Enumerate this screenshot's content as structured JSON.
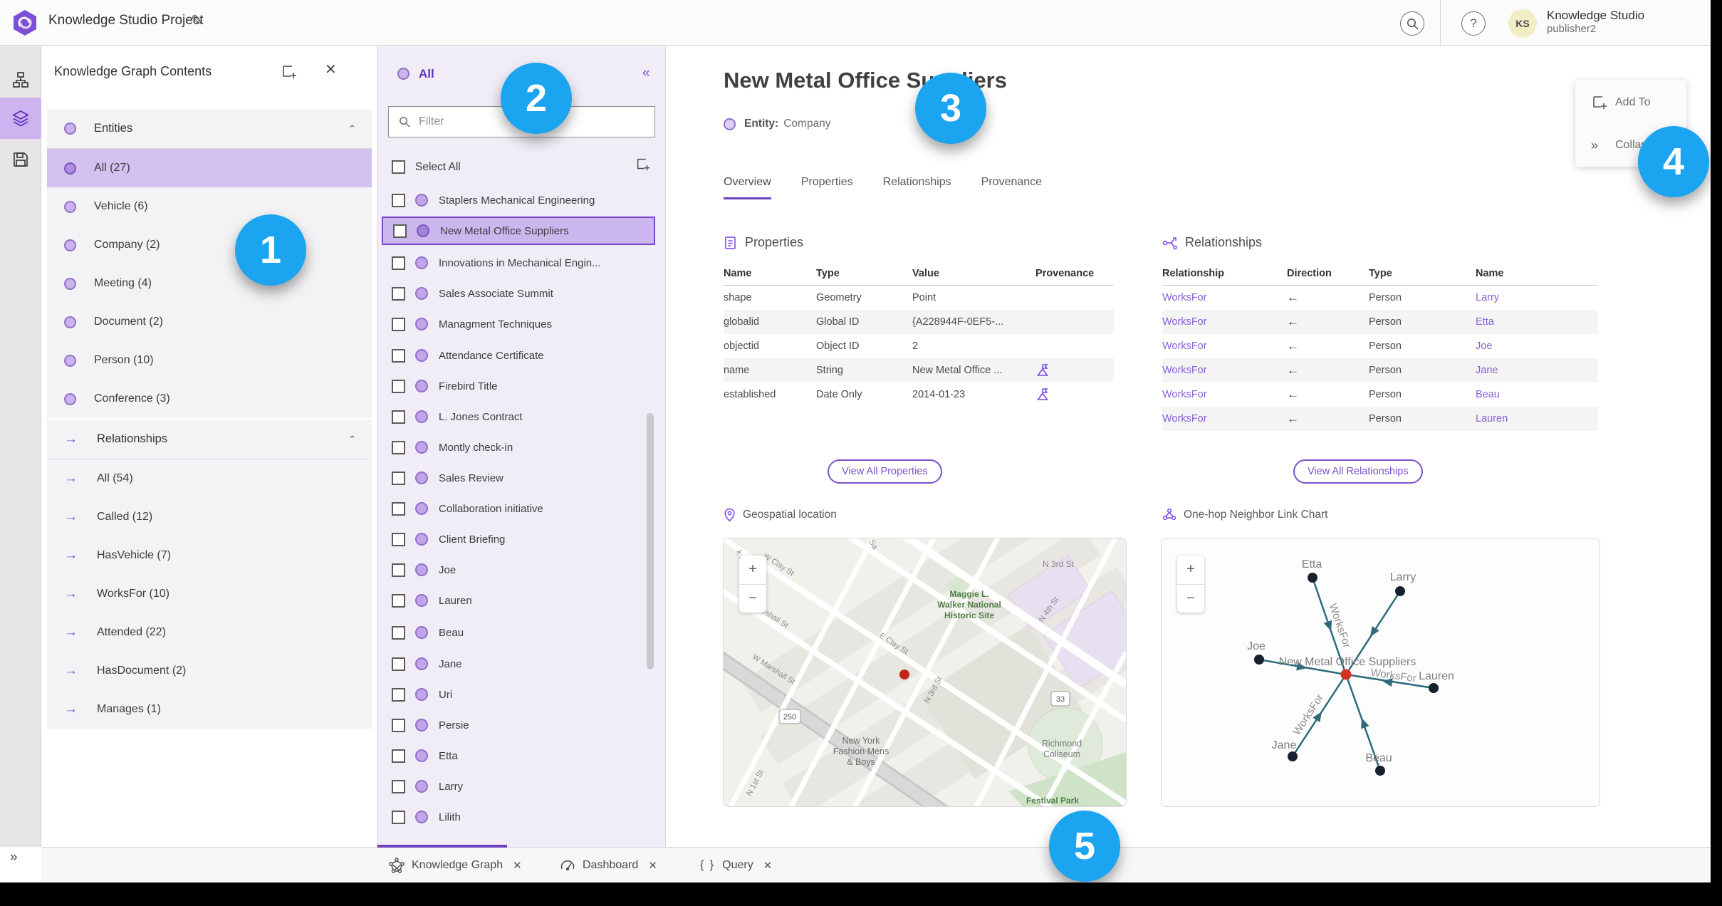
{
  "header": {
    "title": "Knowledge Studio Project",
    "search_tooltip": "search",
    "help_label": "?",
    "avatar_initials": "KS",
    "user_org": "Knowledge Studio",
    "user_name": "publisher2"
  },
  "sidebar": {
    "title": "Knowledge Graph Contents",
    "entities": {
      "label": "Entities",
      "items": [
        {
          "label": "All (27)",
          "selected": true
        },
        {
          "label": "Vehicle (6)"
        },
        {
          "label": "Company (2)"
        },
        {
          "label": "Meeting (4)"
        },
        {
          "label": "Document (2)"
        },
        {
          "label": "Person (10)"
        },
        {
          "label": "Conference (3)"
        }
      ]
    },
    "relationships": {
      "label": "Relationships",
      "items": [
        {
          "label": "All (54)"
        },
        {
          "label": "Called (12)"
        },
        {
          "label": "HasVehicle (7)"
        },
        {
          "label": "WorksFor (10)"
        },
        {
          "label": "Attended (22)"
        },
        {
          "label": "HasDocument (2)"
        },
        {
          "label": "Manages (1)"
        }
      ]
    }
  },
  "list_panel": {
    "header": "All",
    "filter_placeholder": "Filter",
    "select_all_label": "Select All",
    "selected_item": "New Metal Office Suppliers",
    "items": [
      "Staplers Mechanical Engineering",
      "New Metal Office Suppliers",
      "Innovations in Mechanical Engin...",
      "Sales Associate Summit",
      "Managment Techniques",
      "Attendance Certificate",
      "Firebird Title",
      "L. Jones Contract",
      "Montly check-in",
      "Sales Review",
      "Collaboration initiative",
      "Client Briefing",
      "Joe",
      "Lauren",
      "Beau",
      "Jane",
      "Uri",
      "Persie",
      "Etta",
      "Larry",
      "Lilith"
    ]
  },
  "detail": {
    "title": "New Metal Office Suppliers",
    "entity_label": "Entity:",
    "entity_type": "Company",
    "tabs": [
      "Overview",
      "Properties",
      "Relationships",
      "Provenance"
    ],
    "active_tab": "Overview",
    "properties": {
      "section_title": "Properties",
      "columns": [
        "Name",
        "Type",
        "Value",
        "Provenance"
      ],
      "rows": [
        {
          "name": "shape",
          "type": "Geometry",
          "value": "Point",
          "provenance": false
        },
        {
          "name": "globalid",
          "type": "Global ID",
          "value": "{A228944F-0EF5-...",
          "provenance": false
        },
        {
          "name": "objectid",
          "type": "Object ID",
          "value": "2",
          "provenance": false
        },
        {
          "name": "name",
          "type": "String",
          "value": "New Metal Office ...",
          "provenance": true
        },
        {
          "name": "established",
          "type": "Date Only",
          "value": "2014-01-23",
          "provenance": true
        }
      ],
      "view_all_label": "View All Properties"
    },
    "relationships": {
      "section_title": "Relationships",
      "columns": [
        "Relationship",
        "Direction",
        "Type",
        "Name"
      ],
      "rows": [
        {
          "relationship": "WorksFor",
          "direction": "←",
          "type": "Person",
          "name": "Larry"
        },
        {
          "relationship": "WorksFor",
          "direction": "←",
          "type": "Person",
          "name": "Etta"
        },
        {
          "relationship": "WorksFor",
          "direction": "←",
          "type": "Person",
          "name": "Joe"
        },
        {
          "relationship": "WorksFor",
          "direction": "←",
          "type": "Person",
          "name": "Jane"
        },
        {
          "relationship": "WorksFor",
          "direction": "←",
          "type": "Person",
          "name": "Beau"
        },
        {
          "relationship": "WorksFor",
          "direction": "←",
          "type": "Person",
          "name": "Lauren"
        }
      ],
      "view_all_label": "View All Relationships"
    },
    "map_section_title": "Geospatial location",
    "link_chart_section_title": "One-hop Neighbor Link Chart"
  },
  "map": {
    "zoom_in": "+",
    "zoom_out": "−",
    "shields": [
      "250",
      "33"
    ],
    "street_labels": [
      "k Rd",
      "W Clay St",
      "Sa",
      "Marshall St",
      "W Marshall St",
      "E Clay St",
      "N 3rd St",
      "N 3rd St",
      "N 4th St",
      "N 1st St"
    ],
    "places": {
      "maggie": [
        "Maggie L.",
        "Walker National",
        "Historic Site"
      ],
      "newyork": [
        "New York",
        "Fashion Mens",
        "& Boys"
      ],
      "coliseum": [
        "Richmond",
        "Coliseum"
      ],
      "festival": "Festival Park"
    }
  },
  "link_chart": {
    "zoom_in": "+",
    "zoom_out": "−",
    "center_node": "New Metal Office Suppliers",
    "edge_label": "WorksFor",
    "nodes": [
      "Etta",
      "Larry",
      "Joe",
      "Lauren",
      "Jane",
      "Beau"
    ],
    "colors": {
      "edge": "#2c6a7c",
      "node": "#17202e",
      "center_node": "#d83020"
    }
  },
  "floating_panel": {
    "add_to_label": "Add To",
    "collapse_label": "Collapse"
  },
  "bottom_tabs": [
    {
      "label": "Knowledge Graph",
      "active": true
    },
    {
      "label": "Dashboard",
      "active": false
    },
    {
      "label": "Query",
      "active": false
    }
  ],
  "callouts": [
    "1",
    "2",
    "3",
    "4",
    "5"
  ],
  "colors": {
    "accent_purple": "#6f42c1",
    "selection_fill": "#cbb6ee",
    "badge_blue": "#1ba4ef",
    "marker_red": "#c1251c"
  }
}
